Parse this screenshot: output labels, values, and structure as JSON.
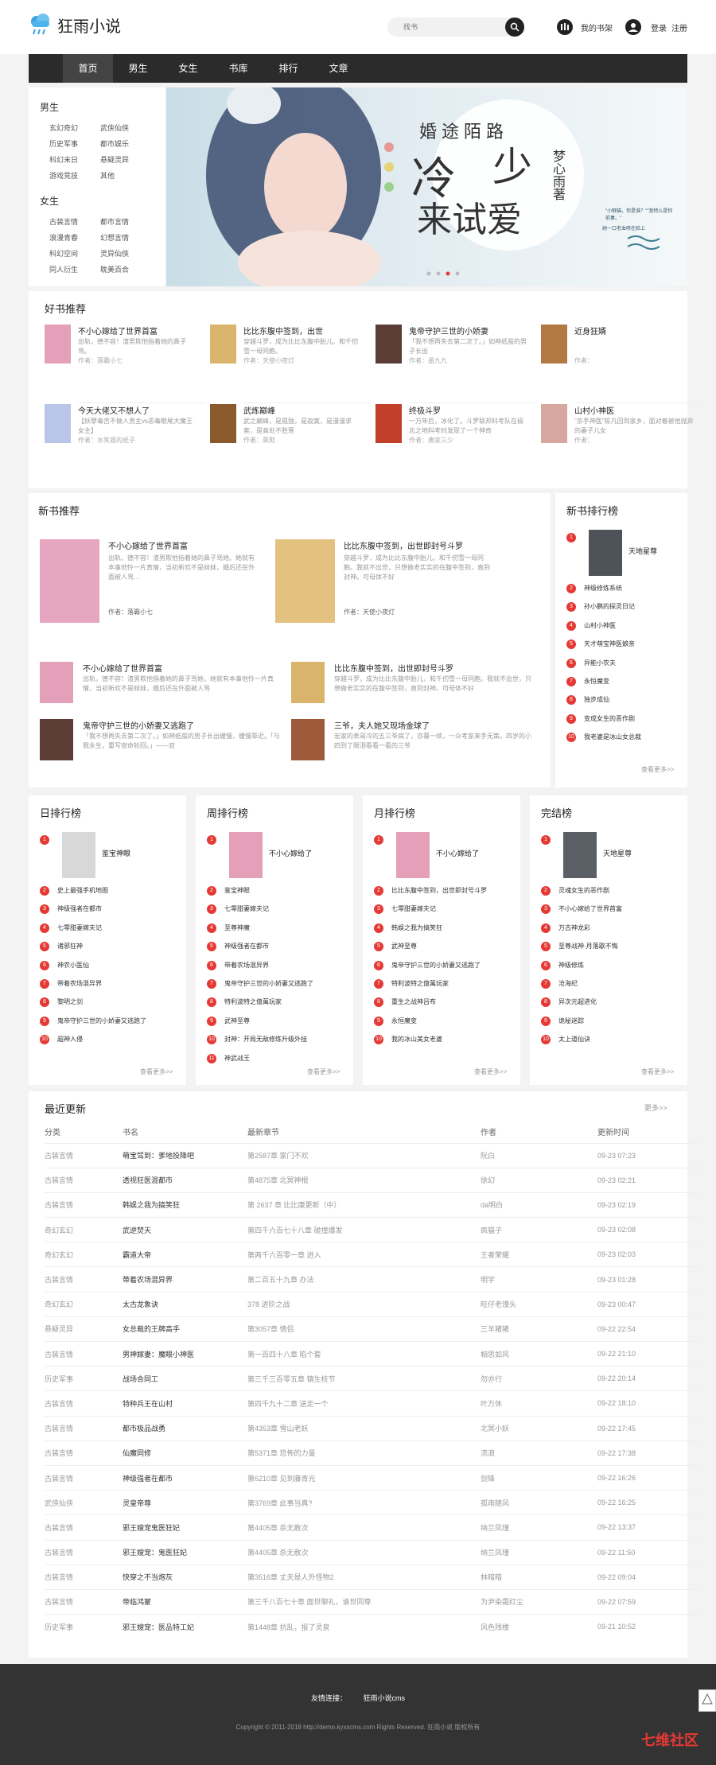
{
  "header": {
    "logo": "狂雨小说",
    "search_placeholder": "找书",
    "shelf": "我的书架",
    "login": "登录",
    "register": "注册"
  },
  "nav": [
    "首页",
    "男生",
    "女生",
    "书库",
    "排行",
    "文章"
  ],
  "sidebar": {
    "male_title": "男生",
    "male": [
      "玄幻奇幻",
      "武侠仙侠",
      "历史军事",
      "都市娱乐",
      "科幻末日",
      "悬疑灵异",
      "游戏竞技",
      "其他"
    ],
    "female_title": "女生",
    "female": [
      "古装言情",
      "都市言情",
      "浪漫青春",
      "幻想言情",
      "科幻空间",
      "灵异仙侠",
      "同人衍生",
      "耽美百合"
    ]
  },
  "banner": {
    "title": "婚途陌路",
    "big1": "冷",
    "big2": "少",
    "big3": "来试爱",
    "author": "梦心雨著",
    "side_text": "\"小野猫，你是谁？\"\"我特么是你前妻。\"",
    "side_text2": "她一口老血喷在脸上"
  },
  "good": {
    "title": "好书推荐",
    "books": [
      {
        "title": "不小心嫁给了世界首富",
        "desc": "出轨，德不容！渣男欺他指着她的鼻子骂。",
        "author": "作者：落霸小七",
        "cover": "#e4a0b8"
      },
      {
        "title": "比比东腹中签到，出世",
        "desc": "穿越斗罗，成为比比东腹中胎儿。和千仞雪一母同胞。",
        "author": "作者：天使小夜灯",
        "cover": "#d9b46a"
      },
      {
        "title": "鬼帝守护三世的小娇妻",
        "desc": "「我不想再失去第二次了。」如神纸般的男子长出",
        "author": "作者：墨九九",
        "cover": "#5b3d36"
      },
      {
        "title": "近身狂婿",
        "desc": "",
        "author": "作者：",
        "cover": "#b07a42"
      },
      {
        "title": "今天大佬又不想人了",
        "desc": "【妖孽毒舌不做人男主vs恶毒眼尾大魔王女主】",
        "author": "作者：水笑眉的纸子",
        "cover": "#b9c6e8"
      },
      {
        "title": "武炼巅峰",
        "desc": "武之巅峰，是孤独，是寂寞，是漫漫求索，是高处不胜寒",
        "author": "作者：莫默",
        "cover": "#8a5a2c"
      },
      {
        "title": "终极斗罗",
        "desc": "一万年后，冰化了。斗罗联邦科考队在极北之地科考时发现了一个神奇",
        "author": "作者：唐家三少",
        "cover": "#c2402a"
      },
      {
        "title": "山村小神医",
        "desc": "\"杀手神医\"陈凡回到家乡，面对着被他抛弃的妻子儿女",
        "author": "作者：",
        "cover": "#d7a7a0"
      }
    ]
  },
  "newrec": {
    "title": "新书推荐",
    "big": [
      {
        "title": "不小心嫁给了世界首富",
        "desc": "出轨，德不容！渣男欺他指着她的鼻子骂她。她就有本事他怜一片真情，当初新欢不是妹妹，婚后还在外面被人骂…",
        "author": "作者：落霸小七",
        "cover": "#e7a6bf"
      },
      {
        "title": "比比东腹中签到，出世即封号斗罗",
        "desc": "穿越斗罗，成为比比东腹中胎儿，和千仞雪一母同胞。我就不出世，只想做老实实的在腹中签到，直到封神。可母体不好",
        "author": "作者：天使小夜灯",
        "cover": "#e3c27f"
      }
    ],
    "small": [
      {
        "title": "不小心嫁给了世界首富",
        "desc": "出轨，德不容！渣男欺他指着她的鼻子骂她，她就有本事他怜一片真情，当初新欢不是妹妹，婚后还在外面被人骂",
        "cover": "#e4a0b8"
      },
      {
        "title": "比比东腹中签到，出世即封号斗罗",
        "desc": "穿越斗罗，成为比比东腹中胎儿，和千仞雪一母同胞。我就不出世，只想做老实实的在腹中签到，直到封神。可母体不好",
        "cover": "#d9b46a"
      },
      {
        "title": "鬼帝守护三世的小娇妻又逃跑了",
        "desc": "「我不想再失去第二次了。」如神纸般的男子长出缓慢，缓慢靠近。「与我永生，重写宿命轮回。」——双",
        "cover": "#5b3d36"
      },
      {
        "title": "三爷，夫人她又现场金球了",
        "desc": "宏家的表哥冷的五三爷病了，亦暮一续，一众考家来手无策。四岁的小四到了眼泪看看一看的三爷",
        "cover": "#9e5a3a"
      }
    ]
  },
  "newrank": {
    "title": "新书排行榜",
    "top": "天地星尊",
    "items": [
      "神级修炼系统",
      "孙小鹏的探灵日记",
      "山村小神医",
      "天才萌宝神医娘亲",
      "异能小农夫",
      "永恒魔变",
      "独步成仙",
      "变成女生的恶作剧",
      "我老婆是冰山女总裁"
    ],
    "more": "查看更多>>"
  },
  "ranks": [
    {
      "title": "日排行榜",
      "top": "鉴宝神眼",
      "items": [
        "史上最强手机地图",
        "神级强者在都市",
        "七零甜妻嫁夫记",
        "诸邪狂神",
        "神农小医仙",
        "带着农场混异界",
        "黎明之剑",
        "鬼帝守护三世的小娇妻又逃跑了",
        "超神入侵"
      ],
      "cover": "#d8d8d8"
    },
    {
      "title": "周排行榜",
      "top": "不小心嫁给了",
      "items": [
        "鉴宝神眼",
        "七零甜妻嫁夫记",
        "至尊神魔",
        "神级强者在都市",
        "带着农场混异界",
        "鬼帝守护三世的小娇妻又逃跑了",
        "特利波特之億萬玩家",
        "武神至尊",
        "封神：开局无敌修炼升级外挂",
        "神武战王"
      ],
      "cover": "#e4a0b8"
    },
    {
      "title": "月排行榜",
      "top": "不小心嫁给了",
      "items": [
        "比比东腹中签到，出世即封号斗罗",
        "七零甜妻嫁夫记",
        "韩娱之我为搞笑狂",
        "武神至尊",
        "鬼帝守护三世的小娇妻又逃跑了",
        "特利波特之億萬玩家",
        "重生之战神吕布",
        "永恒魔变",
        "我的冰山美女老婆"
      ],
      "cover": "#e4a0b8"
    },
    {
      "title": "完结榜",
      "top": "天地星尊",
      "items": [
        "灵魂女生的恶作剧",
        "不小心嫁给了世界首富",
        "万古神龙彩",
        "至尊战神·月落歌不悔",
        "神级修炼",
        "沧海纪",
        "异次元超进化",
        "诡秘迷踪",
        "太上道仙诀"
      ],
      "cover": "#5a6066"
    }
  ],
  "more": "查看更多>>",
  "latest": {
    "title": "最近更新",
    "more": "更多>>",
    "headers": [
      "分类",
      "书名",
      "最新章节",
      "作者",
      "更新时间"
    ],
    "rows": [
      [
        "古装言情",
        "萌宝驾到：爹地投降吧",
        "第2587章 家门不欢",
        "阮白",
        "09-23 07:23"
      ],
      [
        "古装言情",
        "透视狂医混都市",
        "第4875章 北冥神棍",
        "徐幻",
        "09-23 02:21"
      ],
      [
        "古装言情",
        "韩娱之我为搞笑狂",
        "第 2637 章 比比康更新（中）",
        "da明白",
        "09-23 02:19"
      ],
      [
        "奇幻玄幻",
        "武逆焚天",
        "第四千六百七十八章 碰撞爆发",
        "疯猫子",
        "09-23 02:08"
      ],
      [
        "奇幻玄幻",
        "霸道大帝",
        "第两千六百零一章 进入",
        "王者荣耀",
        "09-23 02:03"
      ],
      [
        "古装言情",
        "带着农场混异界",
        "第二百五十九章 办法",
        "明宇",
        "09-23 01:28"
      ],
      [
        "奇幻玄幻",
        "太古龙象诀",
        "378 进阶之战",
        "旺仔老馒头",
        "09-23 00:47"
      ],
      [
        "悬疑灵异",
        "女总裁的王牌高手",
        "第3057章 情侣",
        "三羊猪猪",
        "09-22 22:54"
      ],
      [
        "古装言情",
        "男神嫁妻：魔眼小神医",
        "第一百四十八章 陷个套",
        "相思如风",
        "09-22 21:10"
      ],
      [
        "历史军事",
        "战场合同工",
        "第三千三百零五章 镇生枝节",
        "勿亦行",
        "09-22 20:14"
      ],
      [
        "古装言情",
        "特种兵王在山村",
        "第四千九十二章 送走一个",
        "叶万休",
        "09-22 18:10"
      ],
      [
        "古装言情",
        "都市极品战勇",
        "第4353章 雪山老妖",
        "北冥小妖",
        "09-22 17:45"
      ],
      [
        "古装言情",
        "仙魔同修",
        "第5371章 恐怖的力量",
        "流浪",
        "09-22 17:38"
      ],
      [
        "古装言情",
        "神级强者在都市",
        "第6210章 见到藤青光",
        "剑锋",
        "09-22 16:26"
      ],
      [
        "武侠仙侠",
        "灵皇帝尊",
        "第3769章 此事当真?",
        "孤雨随风",
        "09-22 16:25"
      ],
      [
        "古装言情",
        "邪王嫂宠鬼医狂妃",
        "第4405章 杀无赦次",
        "纳兰凤瑾",
        "09-22 13:37"
      ],
      [
        "古装言情",
        "邪王嫂宠：鬼医狂妃",
        "第4405章 杀无赦次",
        "纳兰凤瑾",
        "09-22 11:50"
      ],
      [
        "古装言情",
        "快穿之不当炮灰",
        "第3516章 丈夫是人外怪物2",
        "林暗暗",
        "09-22 09:04"
      ],
      [
        "古装言情",
        "帝临鸿蒙",
        "第三千八百七十章 面世聊礼，谁世同尊",
        "为尹染霜红尘",
        "09-22 07:59"
      ],
      [
        "历史军事",
        "邪王嫂宠：医品特工妃",
        "第1448章 抗乱，报了灵泉",
        "风色残楼",
        "09-21 10:52"
      ]
    ]
  },
  "footer": {
    "links_label": "友情连接：",
    "link": "狂雨小说cms",
    "copyright": "Copyright © 2011-2018 http://demo.kyxscms.com Rights Reserved. 狂雨小说 版权所有"
  },
  "watermark": "七维社区"
}
